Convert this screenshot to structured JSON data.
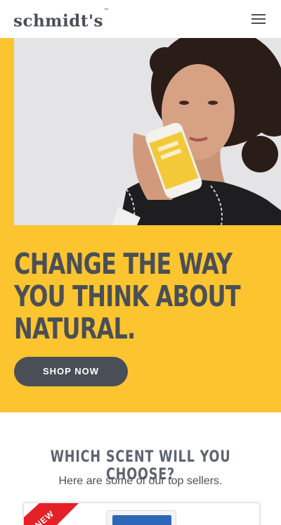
{
  "header": {
    "logo_text": "schmidt's",
    "logo_mark": "™",
    "menu_icon": "hamburger-menu-icon"
  },
  "hero": {
    "background_color": "#fcc42e",
    "image_alt": "woman holding schmidt's deodorant stick",
    "title_lines": [
      "CHANGE THE WAY",
      "YOU THINK ABOUT",
      "NATURAL."
    ],
    "cta_label": "SHOP NOW"
  },
  "scent_section": {
    "title": "WHICH SCENT WILL YOU CHOOSE?",
    "subtitle": "Here are some of our top sellers.",
    "product_badge": "NEW",
    "badge_color": "#e52128"
  },
  "colors": {
    "brand_dark": "#4a4f57",
    "accent_yellow": "#fcc42e"
  }
}
